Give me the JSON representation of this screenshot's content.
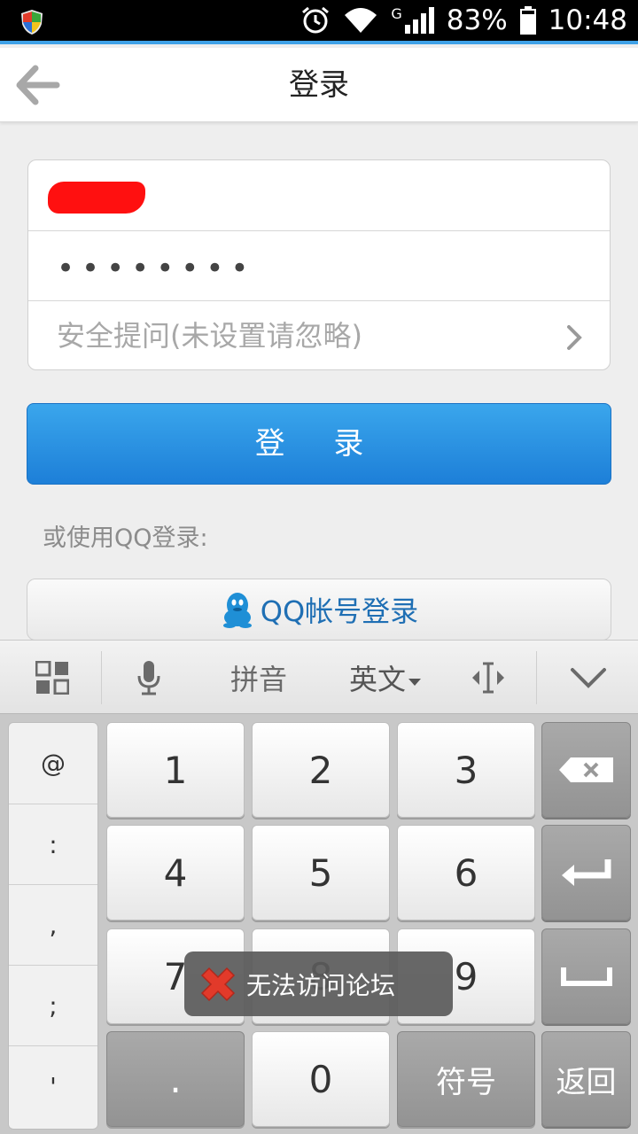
{
  "status_bar": {
    "network": "G",
    "battery": "83%",
    "time": "10:48"
  },
  "header": {
    "title": "登录",
    "back_icon": "arrow-left-icon"
  },
  "form": {
    "password_mask": "••••••••",
    "security_question_placeholder": "安全提问(未设置请忽略)"
  },
  "login_button": {
    "label": "登 录"
  },
  "alt_login_text": "或使用QQ登录:",
  "qq_button": {
    "label": "QQ帐号登录",
    "icon": "qq-penguin-icon"
  },
  "keyboard": {
    "toolbar": {
      "pinyin": "拼音",
      "english": "英文"
    },
    "side_keys": [
      "@",
      ":",
      ",",
      ";",
      "'"
    ],
    "digit_rows": [
      [
        "1",
        "2",
        "3"
      ],
      [
        "4",
        "5",
        "6"
      ],
      [
        "7",
        "8",
        "9"
      ]
    ],
    "bottom_row": {
      "dot": ".",
      "zero": "0",
      "symbols": "符号"
    },
    "back_key": "返回"
  },
  "toast": {
    "message": "无法访问论坛",
    "icon": "error-x-icon"
  },
  "colors": {
    "accent": "#1d7fd8",
    "qq_text": "#1f6fb4",
    "status_line": "#3fa1e6"
  }
}
